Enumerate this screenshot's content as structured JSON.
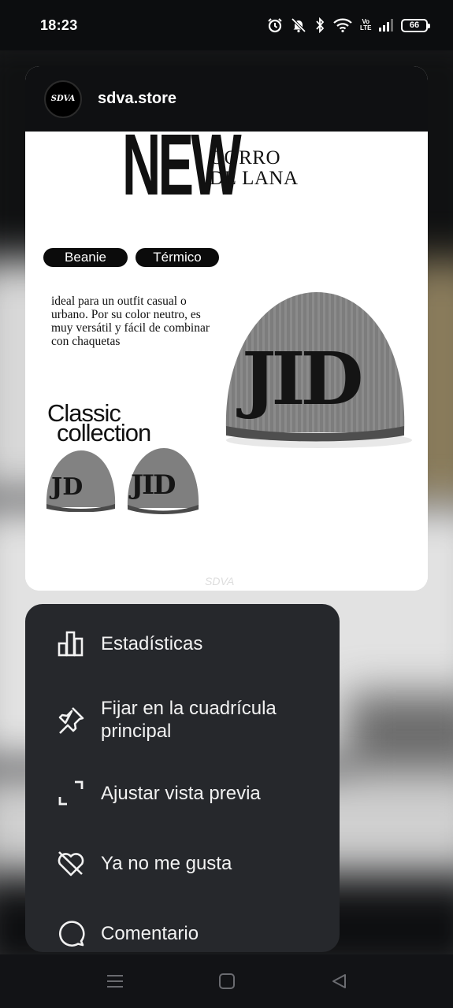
{
  "status_bar": {
    "time": "18:23",
    "volte_label": "Vo LTE",
    "battery_level": "66",
    "icons": [
      "alarm-icon",
      "mute-icon",
      "bluetooth-icon",
      "wifi-icon",
      "volte-icon",
      "signal-icon",
      "battery-icon"
    ]
  },
  "post": {
    "username": "sdva.store",
    "avatar_text": "SDVA",
    "image": {
      "headline": "NEW",
      "subhead_line1": "GORRO",
      "subhead_line2": "DE LANA",
      "tags": [
        "Beanie",
        "Térmico"
      ],
      "description": "ideal para un outfit casual o urbano. Por su color neutro, es muy versátil y fácil de combinar con chaquetas",
      "collection_line1": "Classic",
      "collection_line2": "collection",
      "hat_logo": "JID"
    }
  },
  "menu": {
    "items": [
      {
        "label": "Estadísticas",
        "icon": "bar-chart-icon"
      },
      {
        "label": "Fijar en la cuadrícula principal",
        "icon": "pin-icon"
      },
      {
        "label": "Ajustar vista previa",
        "icon": "crop-corners-icon"
      },
      {
        "label": "Ya no me gusta",
        "icon": "heart-crossed-icon"
      },
      {
        "label": "Comentario",
        "icon": "comment-bubble-icon"
      }
    ]
  },
  "nav_bar": {
    "icons": [
      "recents-icon",
      "home-icon",
      "back-icon"
    ]
  },
  "colors": {
    "menu_bg": "#26282c",
    "status_bg": "#0c0d0f",
    "text": "#f2f2f2"
  }
}
